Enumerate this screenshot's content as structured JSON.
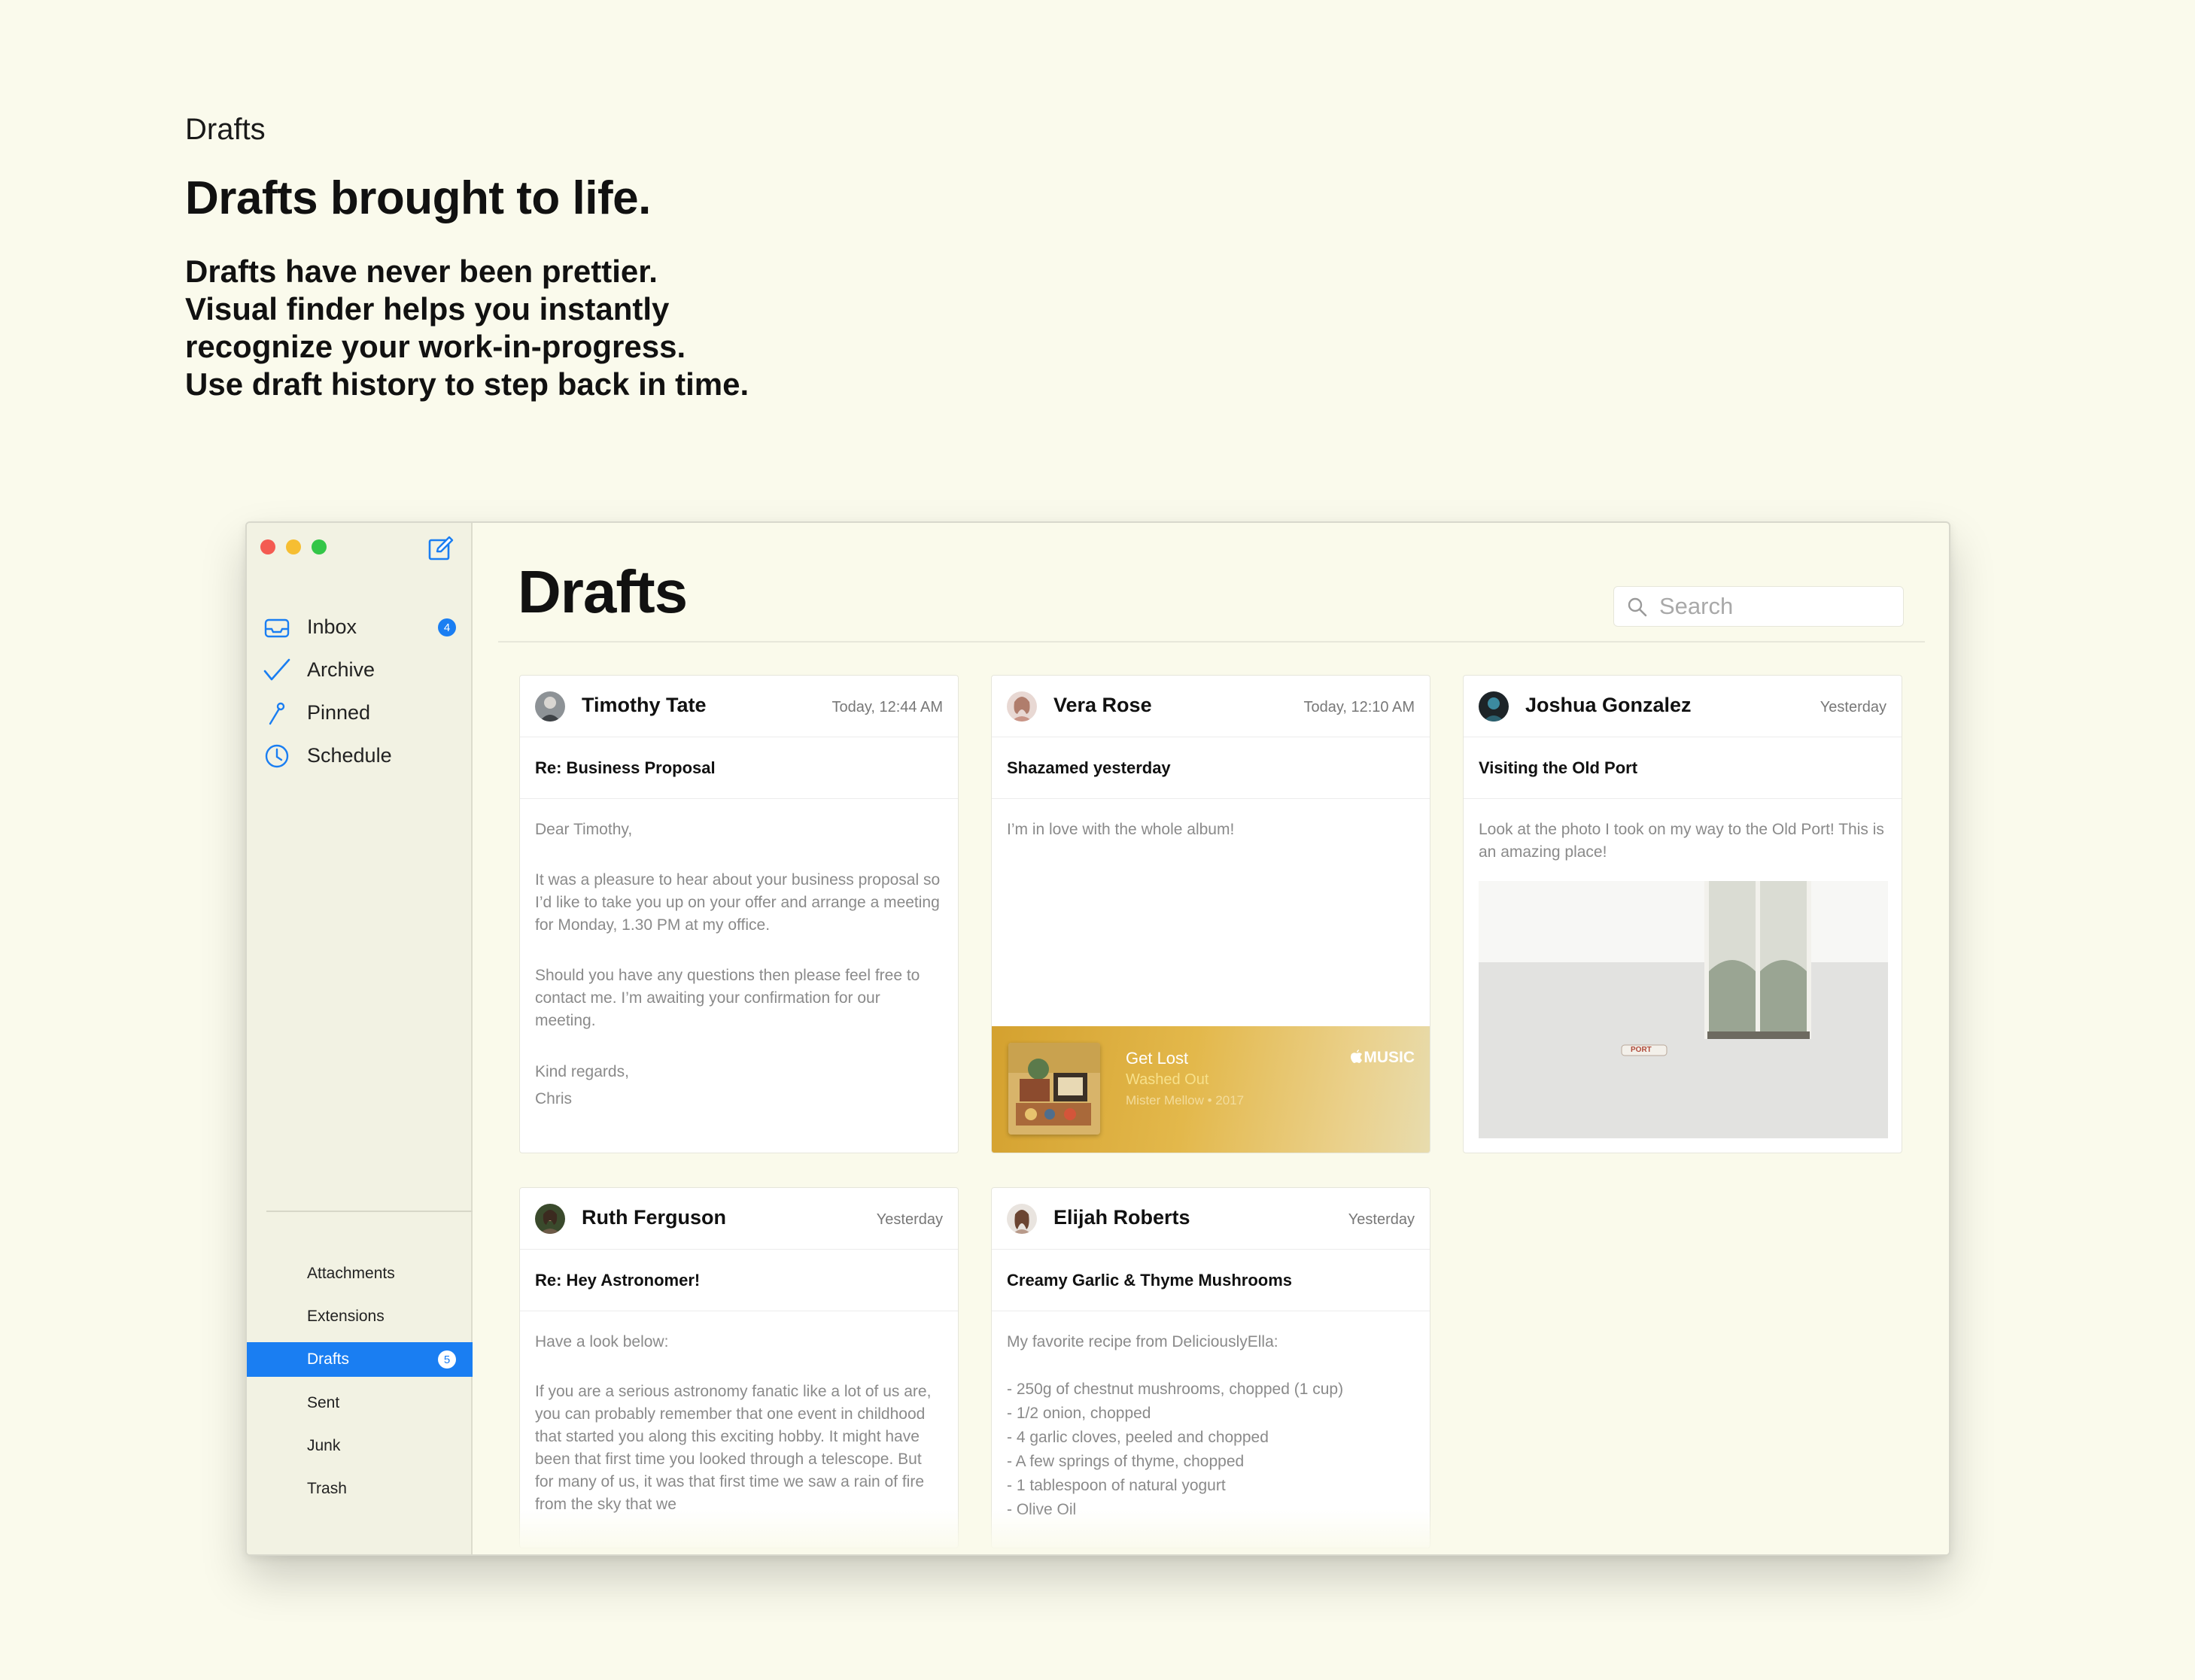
{
  "hero": {
    "eyebrow": "Drafts",
    "title": "Drafts brought to life.",
    "description": [
      "Drafts have never been prettier.",
      "Visual finder helps you instantly",
      "recognize your work-in-progress.",
      "Use draft history to step back in time."
    ]
  },
  "sidebar": {
    "nav": [
      {
        "label": "Inbox",
        "icon": "inbox-icon",
        "badge": "4"
      },
      {
        "label": "Archive",
        "icon": "checkmark-icon"
      },
      {
        "label": "Pinned",
        "icon": "pin-icon"
      },
      {
        "label": "Schedule",
        "icon": "clock-icon"
      }
    ],
    "folders": [
      {
        "label": "Attachments"
      },
      {
        "label": "Extensions"
      },
      {
        "label": "Drafts",
        "badge": "5",
        "active": true
      },
      {
        "label": "Sent"
      },
      {
        "label": "Junk"
      },
      {
        "label": "Trash"
      }
    ]
  },
  "main": {
    "title": "Drafts",
    "search_placeholder": "Search"
  },
  "cards": [
    {
      "sender": "Timothy Tate",
      "time": "Today, 12:44 AM",
      "subject": "Re: Business Proposal",
      "body": [
        "Dear Timothy,",
        "It was a pleasure to hear about your business proposal so I’d like to take you up on your offer and arrange a meeting for Monday, 1.30 PM at my office.",
        "Should you have any questions then please feel free to contact me. I’m awaiting your confirmation for our meeting.",
        "Kind regards,",
        "Chris"
      ]
    },
    {
      "sender": "Vera Rose",
      "time": "Today, 12:10 AM",
      "subject": "Shazamed yesterday",
      "body": [
        "I’m in love with the whole album!"
      ],
      "music": {
        "title": "Get Lost",
        "artist": "Washed Out",
        "meta": "Mister Mellow • 2017",
        "brand": "MUSIC"
      }
    },
    {
      "sender": "Joshua Gonzalez",
      "time": "Yesterday",
      "subject": "Visiting the Old Port",
      "body": [
        "Look at the photo I took on my way to the Old Port! This is an amazing place!"
      ],
      "photo_sign": "PORT"
    },
    {
      "sender": "Ruth Ferguson",
      "time": "Yesterday",
      "subject": "Re: Hey Astronomer!",
      "body": [
        "Have a look below:",
        "If you are a serious astronomy fanatic like a lot of us are, you can probably remember that one event in childhood that started you along this exciting hobby. It might have been that first time you looked through a telescope. But for many of us, it was that first time we saw a rain of fire from the sky that we"
      ]
    },
    {
      "sender": "Elijah Roberts",
      "time": "Yesterday",
      "subject": "Creamy Garlic & Thyme Mushrooms",
      "intro": "My favorite recipe from DeliciouslyElla:",
      "list": [
        "- 250g of chestnut mushrooms, chopped (1 cup)",
        "- 1/2 onion, chopped",
        "- 4 garlic cloves, peeled and chopped",
        "- A few springs of thyme, chopped",
        "- 1 tablespoon of natural yogurt",
        "- Olive Oil"
      ]
    }
  ],
  "colors": {
    "background": "#fafaec",
    "accent": "#1a7ef2",
    "sidebar": "#f2f2e3"
  }
}
